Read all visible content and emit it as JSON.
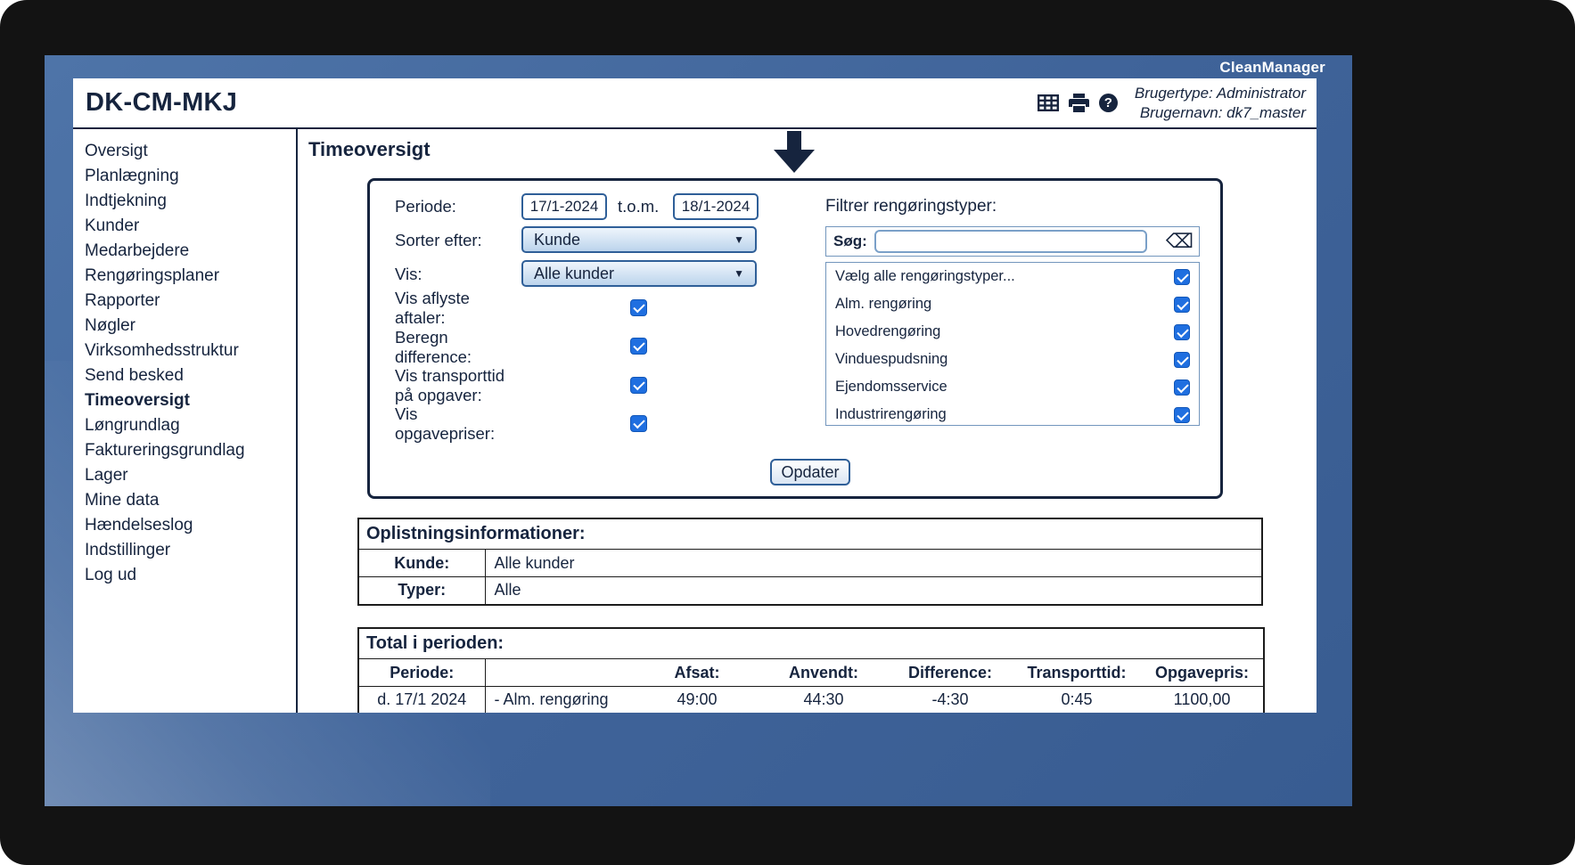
{
  "brand": "CleanManager",
  "window": {
    "title": "DK-CM-MKJ"
  },
  "header": {
    "usertype": "Brugertype: Administrator",
    "username": "Brugernavn: dk7_master"
  },
  "icons": {
    "table": "table-grid-icon",
    "print": "printer-icon",
    "help_glyph": "?",
    "clear_search": "⌫",
    "dropdown_arrow": "▼"
  },
  "colors": {
    "checkbox_blue": "#1f6fe0",
    "panel_border_navy": "#16243e",
    "control_border_blue": "#2f5f98",
    "screen_blue": "#45699e"
  },
  "sidebar": {
    "active_item": "Timeoversigt",
    "items": [
      "Oversigt",
      "Planlægning",
      "Indtjekning",
      "Kunder",
      "Medarbejdere",
      "Rengøringsplaner",
      "Rapporter",
      "Nøgler",
      "Virksomhedsstruktur",
      "Send besked",
      "Timeoversigt",
      "Løngrundlag",
      "Faktureringsgrundlag",
      "Lager",
      "Mine data",
      "Hændelseslog",
      "Indstillinger",
      "Log ud"
    ]
  },
  "main": {
    "title": "Timeoversigt",
    "filter": {
      "periode_label": "Periode:",
      "periode_from": "17/1-2024",
      "tom_label": "t.o.m.",
      "periode_to": "18/1-2024",
      "sorter_label": "Sorter efter:",
      "sorter_value": "Kunde",
      "vis_label": "Vis:",
      "vis_value": "Alle kunder",
      "options": [
        {
          "label": "Vis aflyste aftaler:",
          "checked": true
        },
        {
          "label": "Beregn difference:",
          "checked": true
        },
        {
          "label": "Vis transporttid på opgaver:",
          "checked": true
        },
        {
          "label": "Vis opgavepriser:",
          "checked": true
        }
      ],
      "types_label": "Filtrer rengøringstyper:",
      "search_label": "Søg:",
      "search_value": "",
      "types": [
        {
          "label": "Vælg alle rengøringstyper...",
          "checked": true
        },
        {
          "label": "Alm. rengøring",
          "checked": true
        },
        {
          "label": "Hovedrengøring",
          "checked": true
        },
        {
          "label": "Vinduespudsning",
          "checked": true
        },
        {
          "label": "Ejendomsservice",
          "checked": true
        },
        {
          "label": "Industrirengøring",
          "checked": true
        }
      ],
      "update_button": "Opdater"
    },
    "info_table": {
      "title": "Oplistningsinformationer:",
      "rows": [
        {
          "label": "Kunde:",
          "value": "Alle kunder"
        },
        {
          "label": "Typer:",
          "value": "Alle"
        }
      ]
    },
    "total_table": {
      "title": "Total i perioden:",
      "headers": [
        "Periode:",
        "",
        "Afsat:",
        "Anvendt:",
        "Difference:",
        "Transporttid:",
        "Opgavepris:"
      ],
      "rows": [
        {
          "cells": [
            "d. 17/1 2024",
            "- Alm. rengøring",
            "49:00",
            "44:30",
            "-4:30",
            "0:45",
            "1100,00"
          ]
        }
      ]
    }
  }
}
